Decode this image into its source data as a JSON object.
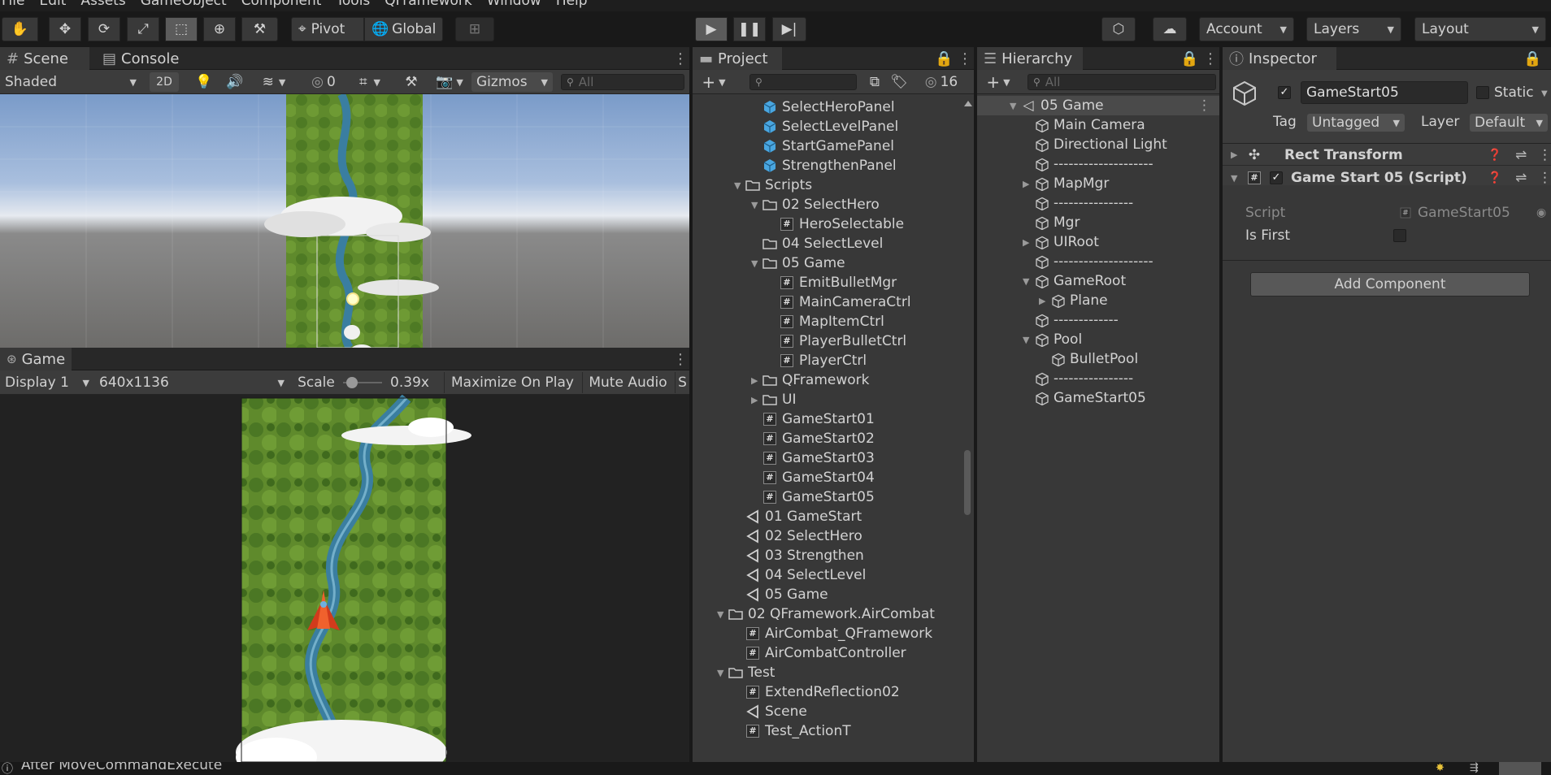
{
  "menu": [
    "File",
    "Edit",
    "Assets",
    "GameObject",
    "Component",
    "Tools",
    "QFramework",
    "Window",
    "Help"
  ],
  "toolbar": {
    "pivot": "Pivot",
    "global": "Global",
    "account": "Account",
    "layers": "Layers",
    "layout": "Layout"
  },
  "scene": {
    "tab_scene": "Scene",
    "tab_console": "Console",
    "shading": "Shaded",
    "mode_2d": "2D",
    "hidden_count": "0",
    "gizmos": "Gizmos",
    "search_placeholder": "All"
  },
  "game": {
    "tab": "Game",
    "display": "Display 1",
    "resolution": "640x1136",
    "scale_label": "Scale",
    "scale_value": "0.39x",
    "maximize": "Maximize On Play",
    "mute": "Mute Audio",
    "stats": "S"
  },
  "project": {
    "tab": "Project",
    "hidden_count": "16",
    "items": [
      {
        "label": "SelectHeroPanel",
        "icon": "prefab",
        "indent": 4,
        "fold": ""
      },
      {
        "label": "SelectLevelPanel",
        "icon": "prefab",
        "indent": 4,
        "fold": ""
      },
      {
        "label": "StartGamePanel",
        "icon": "prefab",
        "indent": 4,
        "fold": ""
      },
      {
        "label": "StrengthenPanel",
        "icon": "prefab",
        "indent": 4,
        "fold": ""
      },
      {
        "label": "Scripts",
        "icon": "folder-open",
        "indent": 3,
        "fold": "open"
      },
      {
        "label": "02 SelectHero",
        "icon": "folder-open",
        "indent": 4,
        "fold": "open"
      },
      {
        "label": "HeroSelectable",
        "icon": "script",
        "indent": 5,
        "fold": ""
      },
      {
        "label": "04 SelectLevel",
        "icon": "folder",
        "indent": 4,
        "fold": ""
      },
      {
        "label": "05 Game",
        "icon": "folder-open",
        "indent": 4,
        "fold": "open"
      },
      {
        "label": "EmitBulletMgr",
        "icon": "script",
        "indent": 5,
        "fold": ""
      },
      {
        "label": "MainCameraCtrl",
        "icon": "script",
        "indent": 5,
        "fold": ""
      },
      {
        "label": "MapItemCtrl",
        "icon": "script",
        "indent": 5,
        "fold": ""
      },
      {
        "label": "PlayerBulletCtrl",
        "icon": "script",
        "indent": 5,
        "fold": ""
      },
      {
        "label": "PlayerCtrl",
        "icon": "script",
        "indent": 5,
        "fold": ""
      },
      {
        "label": "QFramework",
        "icon": "folder",
        "indent": 4,
        "fold": "closed"
      },
      {
        "label": "UI",
        "icon": "folder",
        "indent": 4,
        "fold": "closed"
      },
      {
        "label": "GameStart01",
        "icon": "script",
        "indent": 4,
        "fold": ""
      },
      {
        "label": "GameStart02",
        "icon": "script",
        "indent": 4,
        "fold": ""
      },
      {
        "label": "GameStart03",
        "icon": "script",
        "indent": 4,
        "fold": ""
      },
      {
        "label": "GameStart04",
        "icon": "script",
        "indent": 4,
        "fold": ""
      },
      {
        "label": "GameStart05",
        "icon": "script",
        "indent": 4,
        "fold": ""
      },
      {
        "label": "01 GameStart",
        "icon": "unity-scene",
        "indent": 3,
        "fold": ""
      },
      {
        "label": "02 SelectHero",
        "icon": "unity-scene",
        "indent": 3,
        "fold": ""
      },
      {
        "label": "03 Strengthen",
        "icon": "unity-scene",
        "indent": 3,
        "fold": ""
      },
      {
        "label": "04 SelectLevel",
        "icon": "unity-scene",
        "indent": 3,
        "fold": ""
      },
      {
        "label": "05 Game",
        "icon": "unity-scene",
        "indent": 3,
        "fold": ""
      },
      {
        "label": "02 QFramework.AirCombat",
        "icon": "folder-open",
        "indent": 2,
        "fold": "open"
      },
      {
        "label": "AirCombat_QFramework",
        "icon": "script",
        "indent": 3,
        "fold": ""
      },
      {
        "label": "AirCombatController",
        "icon": "script",
        "indent": 3,
        "fold": ""
      },
      {
        "label": "Test",
        "icon": "folder-open",
        "indent": 2,
        "fold": "open"
      },
      {
        "label": "ExtendReflection02",
        "icon": "script",
        "indent": 3,
        "fold": ""
      },
      {
        "label": "Scene",
        "icon": "unity-scene",
        "indent": 3,
        "fold": ""
      },
      {
        "label": "Test_ActionT",
        "icon": "script",
        "indent": 3,
        "fold": ""
      }
    ]
  },
  "hierarchy": {
    "tab": "Hierarchy",
    "search_placeholder": "All",
    "scene_name": "05 Game",
    "items": [
      {
        "label": "Main Camera",
        "indent": 1,
        "fold": ""
      },
      {
        "label": "Directional Light",
        "indent": 1,
        "fold": ""
      },
      {
        "label": "--------------------",
        "indent": 1,
        "fold": ""
      },
      {
        "label": "MapMgr",
        "indent": 1,
        "fold": "closed"
      },
      {
        "label": "----------------",
        "indent": 1,
        "fold": ""
      },
      {
        "label": "Mgr",
        "indent": 1,
        "fold": ""
      },
      {
        "label": "UIRoot",
        "indent": 1,
        "fold": "closed"
      },
      {
        "label": "--------------------",
        "indent": 1,
        "fold": ""
      },
      {
        "label": "GameRoot",
        "indent": 1,
        "fold": "open"
      },
      {
        "label": "Plane",
        "indent": 2,
        "fold": "closed"
      },
      {
        "label": "-------------",
        "indent": 1,
        "fold": ""
      },
      {
        "label": "Pool",
        "indent": 1,
        "fold": "open"
      },
      {
        "label": "BulletPool",
        "indent": 2,
        "fold": ""
      },
      {
        "label": "----------------",
        "indent": 1,
        "fold": ""
      },
      {
        "label": "GameStart05",
        "indent": 1,
        "fold": ""
      }
    ]
  },
  "inspector": {
    "tab": "Inspector",
    "object_name": "GameStart05",
    "static_label": "Static",
    "tag_label": "Tag",
    "tag_value": "Untagged",
    "layer_label": "Layer",
    "layer_value": "Default",
    "rect_transform": "Rect Transform",
    "component_name": "Game Start 05 (Script)",
    "script_label": "Script",
    "script_value": "GameStart05",
    "is_first_label": "Is First",
    "add_component": "Add Component"
  },
  "status": {
    "message": "After MoveCommandExecute"
  }
}
